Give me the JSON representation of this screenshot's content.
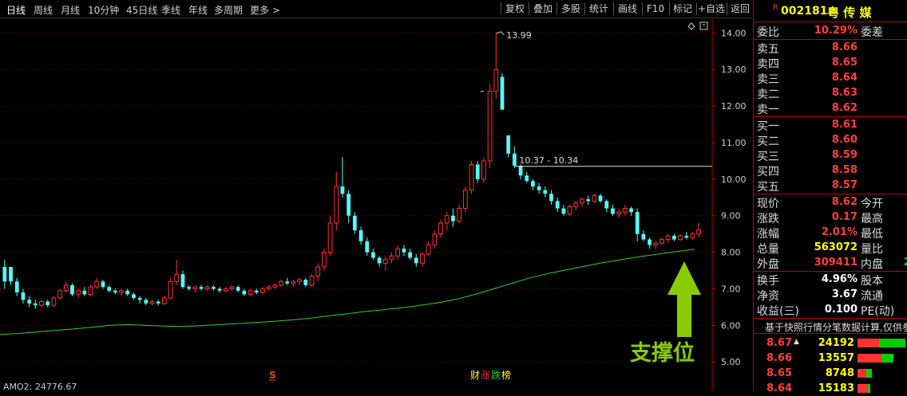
{
  "periods": [
    "日线",
    "周线",
    "月线",
    "10分钟",
    "45日线",
    "季线",
    "年线",
    "多周期",
    "更多 >"
  ],
  "tools": [
    "复权",
    "叠加",
    "多股",
    "统计",
    "画线",
    "F10",
    "标记",
    "+自选",
    "返回"
  ],
  "stock": {
    "badge": "R",
    "code": "002181",
    "name": "粤 传 媒"
  },
  "weibi": {
    "label": "委比",
    "value": "10.29%",
    "label2": "委差"
  },
  "asks": [
    {
      "label": "卖五",
      "price": "8.66"
    },
    {
      "label": "卖四",
      "price": "8.65"
    },
    {
      "label": "卖三",
      "price": "8.64"
    },
    {
      "label": "卖二",
      "price": "8.63"
    },
    {
      "label": "卖一",
      "price": "8.62"
    }
  ],
  "bids": [
    {
      "label": "买一",
      "price": "8.61"
    },
    {
      "label": "买二",
      "price": "8.60"
    },
    {
      "label": "买三",
      "price": "8.59"
    },
    {
      "label": "买四",
      "price": "8.58"
    },
    {
      "label": "买五",
      "price": "8.57"
    }
  ],
  "quote": [
    {
      "label": "现价",
      "value": "8.62",
      "label2": "今开"
    },
    {
      "label": "涨跌",
      "value": "0.17",
      "label2": "最高"
    },
    {
      "label": "涨幅",
      "value": "2.01%",
      "label2": "最低"
    },
    {
      "label": "总量",
      "value": "563072",
      "label2": "量比"
    },
    {
      "label": "外盘",
      "value": "309411",
      "label2": "内盘",
      "extra": "2"
    }
  ],
  "stats": [
    {
      "label": "换手",
      "value": "4.96%",
      "label2": "股本"
    },
    {
      "label": "净资",
      "value": "3.67",
      "label2": "流通"
    },
    {
      "label": "收益(三)",
      "value": "0.100",
      "label2": "PE(动)"
    }
  ],
  "note": "基于快照行情分笔数据计算,仅供参",
  "ticks": [
    {
      "price": "8.67",
      "arrow": "▲",
      "vol": "24192",
      "red": 0.45,
      "green": 0.55
    },
    {
      "price": "8.66",
      "vol": "13557",
      "red": 0.5,
      "green": 0.25
    },
    {
      "price": "8.65",
      "vol": "8748",
      "red": 0.18,
      "green": 0.12
    },
    {
      "price": "8.64",
      "vol": "15183",
      "red": 0.22,
      "green": 0.05
    }
  ],
  "annotations": {
    "peak": "13.99",
    "range": "10.37 - 10.34",
    "support": "支撑位",
    "indicator": "AMO2: 24776.67",
    "news_marker": "S",
    "tags": [
      "财",
      "涨",
      "跌",
      "榜"
    ]
  },
  "colors": {
    "up": "#ff3232",
    "down": "#54fcfc",
    "ma": "#33cc33",
    "support_arrow": "#88cc00",
    "grid": "#7a0000"
  },
  "chart_data": {
    "type": "candlestick",
    "y_ticks": [
      "14.00",
      "13.00",
      "12.00",
      "11.00",
      "10.00",
      "9.00",
      "8.00",
      "7.00",
      "6.00",
      "5.00"
    ],
    "ylim": [
      4.7,
      14.4
    ],
    "candles": [
      [
        7.2,
        7.8,
        7.0,
        7.6,
        0
      ],
      [
        7.6,
        7.6,
        7.1,
        7.2,
        0
      ],
      [
        7.2,
        7.3,
        6.8,
        6.9,
        0
      ],
      [
        6.9,
        7.0,
        6.6,
        6.7,
        0
      ],
      [
        6.7,
        6.8,
        6.5,
        6.6,
        0
      ],
      [
        6.6,
        6.7,
        6.45,
        6.55,
        0
      ],
      [
        6.55,
        6.7,
        6.5,
        6.65,
        1
      ],
      [
        6.65,
        6.7,
        6.5,
        6.55,
        0
      ],
      [
        6.55,
        6.8,
        6.5,
        6.75,
        1
      ],
      [
        6.75,
        7.0,
        6.7,
        6.95,
        1
      ],
      [
        6.95,
        7.2,
        6.9,
        7.1,
        1
      ],
      [
        7.1,
        7.15,
        6.8,
        6.85,
        0
      ],
      [
        6.85,
        7.0,
        6.75,
        6.95,
        1
      ],
      [
        6.95,
        7.05,
        6.8,
        6.85,
        0
      ],
      [
        6.85,
        7.1,
        6.8,
        7.05,
        1
      ],
      [
        7.05,
        7.3,
        7.0,
        7.2,
        1
      ],
      [
        7.2,
        7.25,
        7.0,
        7.05,
        0
      ],
      [
        7.05,
        7.1,
        6.9,
        6.95,
        0
      ],
      [
        6.95,
        7.0,
        6.85,
        6.9,
        0
      ],
      [
        6.9,
        7.0,
        6.8,
        6.95,
        1
      ],
      [
        6.95,
        7.0,
        6.8,
        6.85,
        0
      ],
      [
        6.85,
        6.9,
        6.7,
        6.75,
        0
      ],
      [
        6.75,
        6.8,
        6.6,
        6.7,
        0
      ],
      [
        6.7,
        6.75,
        6.55,
        6.6,
        0
      ],
      [
        6.6,
        6.7,
        6.55,
        6.65,
        1
      ],
      [
        6.65,
        6.7,
        6.55,
        6.6,
        0
      ],
      [
        6.6,
        6.8,
        6.55,
        6.75,
        1
      ],
      [
        6.75,
        7.3,
        6.7,
        7.2,
        1
      ],
      [
        7.2,
        7.8,
        7.1,
        7.4,
        1
      ],
      [
        7.4,
        7.5,
        7.0,
        7.05,
        0
      ],
      [
        7.05,
        7.1,
        6.95,
        7.0,
        0
      ],
      [
        7.0,
        7.1,
        6.9,
        7.05,
        1
      ],
      [
        7.05,
        7.1,
        6.95,
        7.0,
        0
      ],
      [
        7.0,
        7.1,
        6.95,
        7.05,
        1
      ],
      [
        7.05,
        7.1,
        6.95,
        7.0,
        0
      ],
      [
        7.0,
        7.05,
        6.9,
        6.95,
        0
      ],
      [
        6.95,
        7.05,
        6.9,
        7.0,
        1
      ],
      [
        7.0,
        7.1,
        6.95,
        7.05,
        1
      ],
      [
        7.05,
        7.1,
        6.9,
        6.95,
        0
      ],
      [
        6.95,
        7.0,
        6.8,
        6.85,
        0
      ],
      [
        6.85,
        7.0,
        6.8,
        6.95,
        1
      ],
      [
        6.95,
        7.0,
        6.85,
        6.9,
        0
      ],
      [
        6.9,
        7.05,
        6.85,
        7.0,
        1
      ],
      [
        7.0,
        7.1,
        6.95,
        7.05,
        1
      ],
      [
        7.05,
        7.15,
        7.0,
        7.1,
        1
      ],
      [
        7.1,
        7.25,
        7.05,
        7.2,
        1
      ],
      [
        7.2,
        7.3,
        7.1,
        7.15,
        0
      ],
      [
        7.15,
        7.25,
        7.05,
        7.2,
        1
      ],
      [
        7.2,
        7.3,
        7.1,
        7.25,
        1
      ],
      [
        7.25,
        7.3,
        7.05,
        7.1,
        0
      ],
      [
        7.1,
        7.4,
        7.05,
        7.35,
        1
      ],
      [
        7.35,
        7.7,
        7.2,
        7.6,
        1
      ],
      [
        7.6,
        8.1,
        7.5,
        8.0,
        1
      ],
      [
        8.0,
        9.0,
        7.9,
        8.8,
        1
      ],
      [
        8.8,
        10.2,
        8.6,
        9.8,
        1
      ],
      [
        9.8,
        10.6,
        9.5,
        9.6,
        0
      ],
      [
        9.6,
        9.7,
        8.8,
        9.0,
        0
      ],
      [
        9.0,
        9.1,
        8.5,
        8.6,
        0
      ],
      [
        8.6,
        8.7,
        8.2,
        8.3,
        0
      ],
      [
        8.3,
        8.4,
        7.9,
        8.0,
        0
      ],
      [
        8.0,
        8.1,
        7.8,
        7.85,
        0
      ],
      [
        7.85,
        7.9,
        7.6,
        7.7,
        0
      ],
      [
        7.7,
        7.9,
        7.5,
        7.8,
        1
      ],
      [
        7.8,
        8.0,
        7.7,
        7.9,
        1
      ],
      [
        7.9,
        8.2,
        7.8,
        8.1,
        1
      ],
      [
        8.1,
        8.2,
        7.9,
        8.0,
        0
      ],
      [
        8.0,
        8.1,
        7.8,
        7.85,
        0
      ],
      [
        7.85,
        7.95,
        7.6,
        7.7,
        0
      ],
      [
        7.7,
        8.0,
        7.6,
        7.95,
        1
      ],
      [
        7.95,
        8.3,
        7.9,
        8.2,
        1
      ],
      [
        8.2,
        8.6,
        8.1,
        8.5,
        1
      ],
      [
        8.5,
        8.9,
        8.4,
        8.8,
        1
      ],
      [
        8.8,
        9.1,
        8.6,
        9.0,
        1
      ],
      [
        9.0,
        9.2,
        8.7,
        8.85,
        0
      ],
      [
        8.85,
        9.3,
        8.8,
        9.2,
        1
      ],
      [
        9.2,
        9.8,
        9.1,
        9.7,
        1
      ],
      [
        9.7,
        10.5,
        9.6,
        10.4,
        1
      ],
      [
        10.4,
        10.5,
        9.9,
        10.0,
        0
      ],
      [
        10.0,
        10.6,
        9.9,
        10.5,
        1
      ],
      [
        10.5,
        12.6,
        10.3,
        12.4,
        1
      ],
      [
        12.4,
        13.99,
        12.2,
        13.0,
        1
      ],
      [
        12.8,
        12.9,
        11.9,
        11.9,
        0
      ],
      [
        11.2,
        11.2,
        10.6,
        10.7,
        0
      ],
      [
        10.7,
        10.9,
        10.3,
        10.37,
        0
      ],
      [
        10.37,
        10.4,
        10.0,
        10.1,
        0
      ],
      [
        10.1,
        10.2,
        9.9,
        9.95,
        0
      ],
      [
        9.95,
        10.0,
        9.7,
        9.8,
        0
      ],
      [
        9.8,
        9.9,
        9.6,
        9.7,
        0
      ],
      [
        9.7,
        9.8,
        9.5,
        9.6,
        0
      ],
      [
        9.6,
        9.7,
        9.3,
        9.4,
        0
      ],
      [
        9.4,
        9.5,
        9.1,
        9.2,
        0
      ],
      [
        9.2,
        9.3,
        9.0,
        9.05,
        0
      ],
      [
        9.05,
        9.3,
        9.0,
        9.25,
        1
      ],
      [
        9.25,
        9.4,
        9.15,
        9.35,
        1
      ],
      [
        9.35,
        9.5,
        9.25,
        9.45,
        1
      ],
      [
        9.45,
        9.55,
        9.3,
        9.4,
        0
      ],
      [
        9.4,
        9.6,
        9.35,
        9.55,
        1
      ],
      [
        9.55,
        9.6,
        9.35,
        9.4,
        0
      ],
      [
        9.4,
        9.45,
        9.1,
        9.2,
        0
      ],
      [
        9.2,
        9.3,
        9.0,
        9.05,
        0
      ],
      [
        9.05,
        9.2,
        8.95,
        9.1,
        1
      ],
      [
        9.1,
        9.3,
        9.0,
        9.2,
        1
      ],
      [
        9.2,
        9.25,
        9.0,
        9.1,
        0
      ],
      [
        9.1,
        9.2,
        8.3,
        8.5,
        0
      ],
      [
        8.5,
        8.6,
        8.3,
        8.35,
        0
      ],
      [
        8.35,
        8.4,
        8.1,
        8.2,
        0
      ],
      [
        8.2,
        8.3,
        8.1,
        8.25,
        1
      ],
      [
        8.25,
        8.4,
        8.2,
        8.35,
        1
      ],
      [
        8.35,
        8.5,
        8.25,
        8.45,
        1
      ],
      [
        8.45,
        8.5,
        8.3,
        8.35,
        0
      ],
      [
        8.35,
        8.5,
        8.3,
        8.45,
        1
      ],
      [
        8.45,
        8.55,
        8.35,
        8.4,
        0
      ],
      [
        8.4,
        8.55,
        8.35,
        8.5,
        1
      ],
      [
        8.5,
        8.8,
        8.4,
        8.62,
        1
      ]
    ],
    "ma": [
      5.75,
      5.78,
      5.82,
      5.86,
      5.9,
      5.95,
      6.0,
      6.02,
      6.0,
      5.98,
      5.97,
      5.99,
      6.02,
      6.05,
      6.08,
      6.11,
      6.15,
      6.2,
      6.26,
      6.32,
      6.38,
      6.43,
      6.48,
      6.55,
      6.62,
      6.72,
      6.85,
      7.0,
      7.15,
      7.3,
      7.42,
      7.52,
      7.62,
      7.72,
      7.8,
      7.88,
      7.95,
      8.02,
      8.08
    ]
  }
}
